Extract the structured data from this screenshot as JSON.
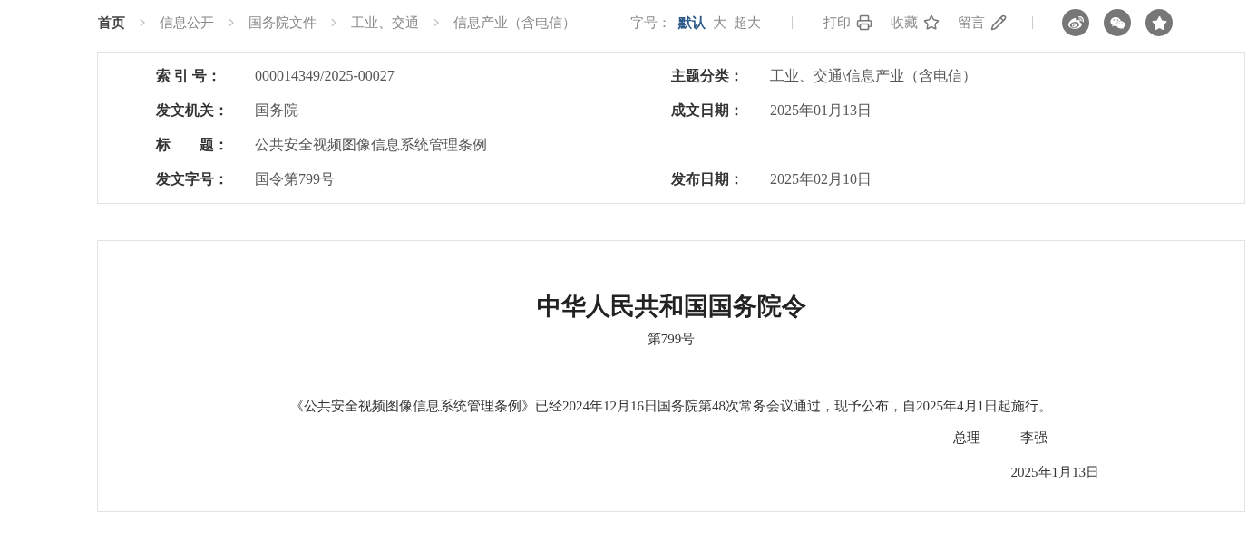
{
  "breadcrumb": [
    {
      "label": "首页",
      "kind": "home"
    },
    {
      "label": "信息公开",
      "kind": "link"
    },
    {
      "label": "国务院文件",
      "kind": "link"
    },
    {
      "label": "工业、交通",
      "kind": "link"
    },
    {
      "label": "信息产业（含电信）",
      "kind": "link"
    }
  ],
  "font_size": {
    "label": "字号：",
    "options": [
      {
        "label": "默认",
        "selected": true
      },
      {
        "label": "大",
        "selected": false
      },
      {
        "label": "超大",
        "selected": false
      }
    ]
  },
  "actions": [
    {
      "label": "打印",
      "kind": "print"
    },
    {
      "label": "收藏",
      "kind": "favorite"
    },
    {
      "label": "留言",
      "kind": "comment"
    }
  ],
  "share": [
    {
      "kind": "weibo"
    },
    {
      "kind": "wechat"
    },
    {
      "kind": "star"
    }
  ],
  "meta": [
    {
      "left": {
        "label": "索 引 号：",
        "value": "000014349/2025-00027"
      },
      "right": {
        "label": "主题分类：",
        "value": "工业、交通\\信息产业（含电信）"
      }
    },
    {
      "left": {
        "label": "发文机关：",
        "value": "国务院"
      },
      "right": {
        "label": "成文日期：",
        "value": "2025年01月13日"
      }
    },
    {
      "left": {
        "label": "标　　题：",
        "value": "公共安全视频图像信息系统管理条例"
      }
    },
    {
      "left": {
        "label": "发文字号：",
        "value": "国令第799号"
      },
      "right": {
        "label": "发布日期：",
        "value": "2025年02月10日"
      }
    }
  ],
  "document": {
    "title": "中华人民共和国国务院令",
    "number": "第799号",
    "body": "《公共安全视频图像信息系统管理条例》已经2024年12月16日国务院第48次常务会议通过，现予公布，自2025年4月1日起施行。",
    "signatory_title": "总理",
    "signatory_name": "李强",
    "date": "2025年1月13日"
  }
}
